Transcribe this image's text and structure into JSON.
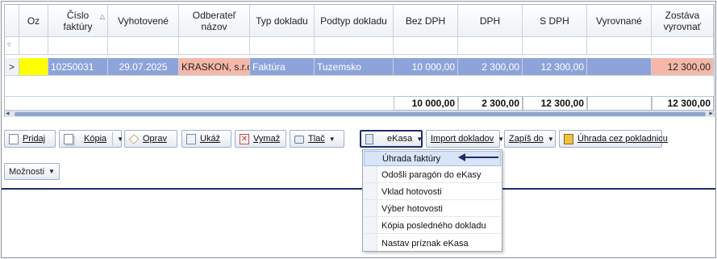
{
  "grid": {
    "headers": [
      "Oz",
      "Číslo faktúry",
      "Vyhotovené",
      "Odberateľ názov",
      "Typ dokladu",
      "Podtyp dokladu",
      "Bez DPH",
      "DPH",
      "S DPH",
      "Vyrovnané",
      "Zostáva vyrovnať"
    ],
    "sort_indicator": "△",
    "filter_icon": "filter-icon",
    "row_indicator": ">",
    "row": {
      "oz": "",
      "number": "10250031",
      "issued": "29.07.2025",
      "customer": "KRASKON, s.r.o.",
      "doc_type": "Faktúra",
      "doc_subtype": "Tuzemsko",
      "net": "10 000,00",
      "vat": "2 300,00",
      "gross": "12 300,00",
      "settled": "",
      "remaining": "12 300,00"
    },
    "totals": {
      "net": "10 000,00",
      "vat": "2 300,00",
      "gross": "12 300,00",
      "remaining": "12 300,00"
    },
    "colors": {
      "selected_row": "#8ea3d9",
      "highlight": "#f5b8a8",
      "oz_flag": "#ffff00"
    }
  },
  "toolbar": {
    "add": "Pridaj",
    "copy": "Kópia",
    "edit": "Oprav",
    "view": "Ukáž",
    "delete": "Vymaž",
    "print": "Tlač",
    "ekasa": "eKasa",
    "import": "Import dokladov",
    "write_to": "Zapíš do",
    "pay_register": "Úhrada cez pokladnicu",
    "options": "Možnosti"
  },
  "ekasa_menu": {
    "items": [
      "Úhrada faktúry",
      "Odošli paragón do eKasy",
      "Vklad hotovosti",
      "Výber hotovosti",
      "Kópia posledného dokladu",
      "Nastav príznak eKasa"
    ]
  }
}
